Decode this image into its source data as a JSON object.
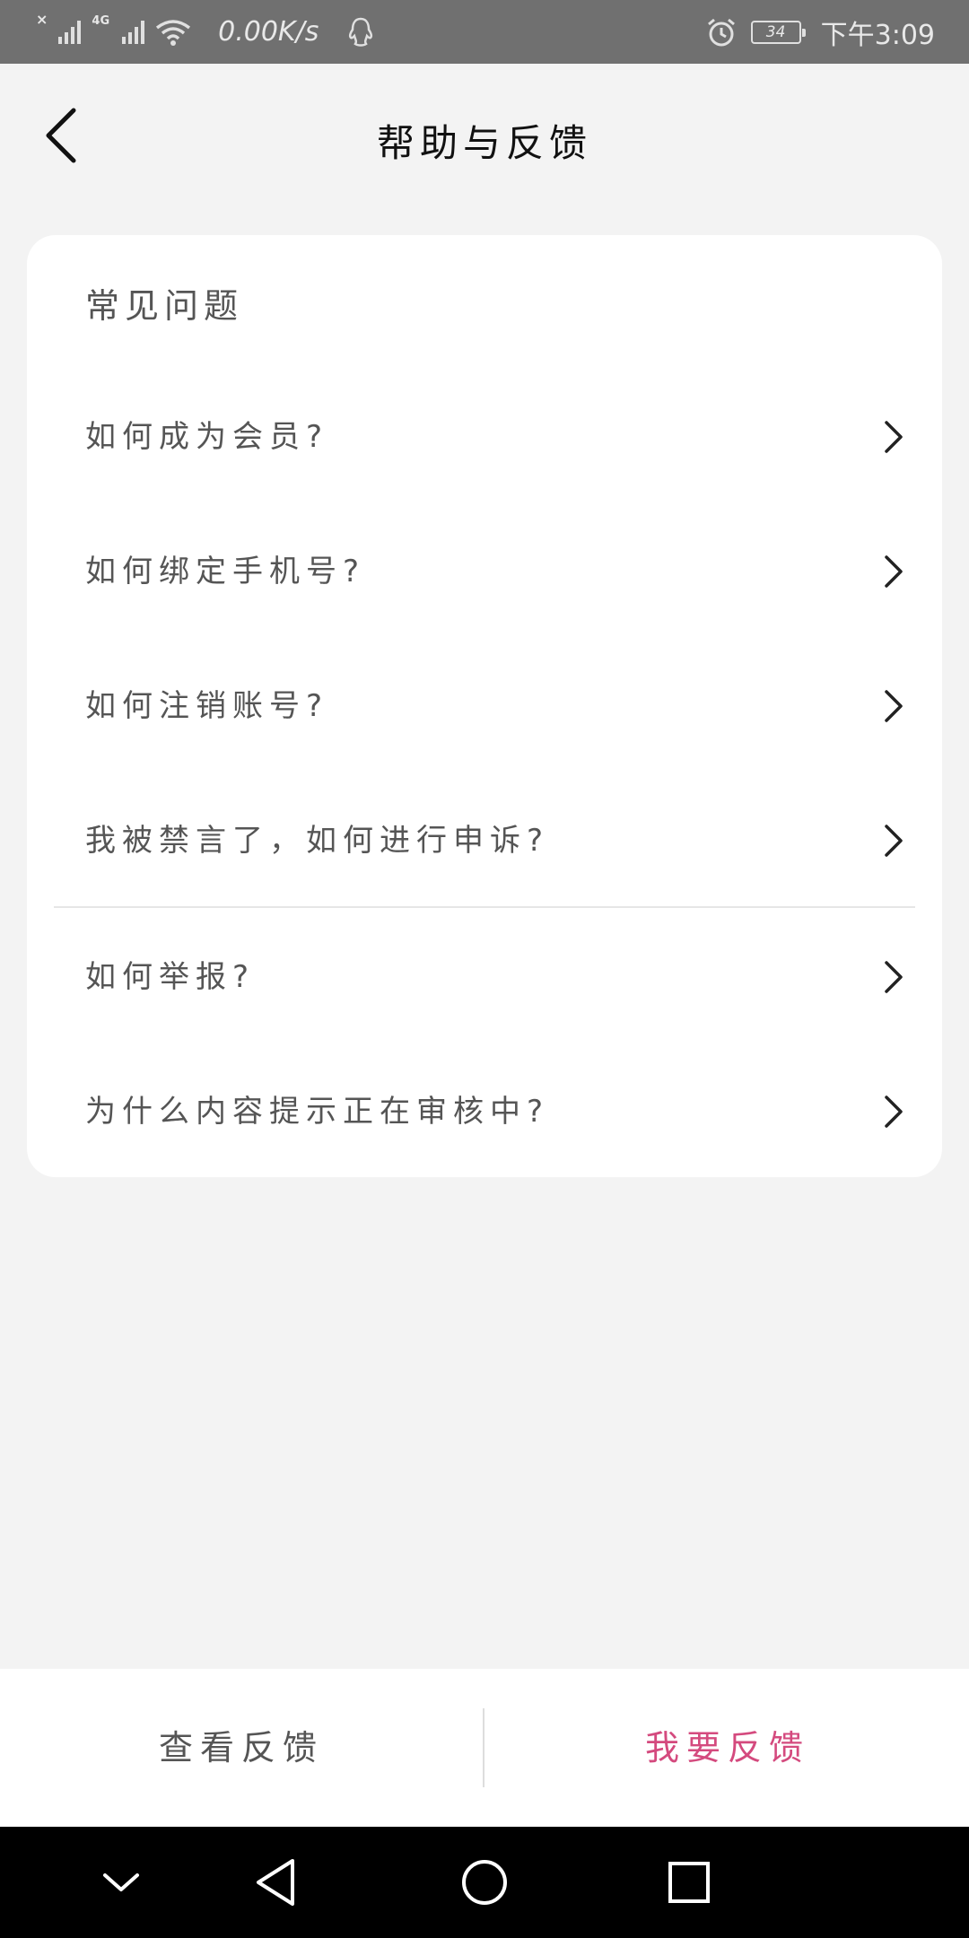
{
  "status_bar": {
    "net_gen": "4G",
    "net_speed": "0.00K/s",
    "battery_level": "34",
    "time": "下午3:09"
  },
  "header": {
    "title": "帮助与反馈"
  },
  "faq": {
    "heading": "常见问题",
    "items": [
      {
        "label": "如何成为会员?"
      },
      {
        "label": "如何绑定手机号?"
      },
      {
        "label": "如何注销账号?"
      },
      {
        "label": "我被禁言了，如何进行申诉?"
      },
      {
        "label": "如何举报?"
      },
      {
        "label": "为什么内容提示正在审核中?"
      }
    ]
  },
  "actions": {
    "view_feedback": "查看反馈",
    "submit_feedback": "我要反馈"
  },
  "colors": {
    "accent": "#d44a7e",
    "background": "#f3f3f3",
    "status_bar": "#707070"
  },
  "icons": {
    "back": "chevron-left-icon",
    "row": "chevron-right-icon",
    "nav": [
      "chevron-down-icon",
      "triangle-back-icon",
      "circle-home-icon",
      "square-recents-icon"
    ]
  }
}
